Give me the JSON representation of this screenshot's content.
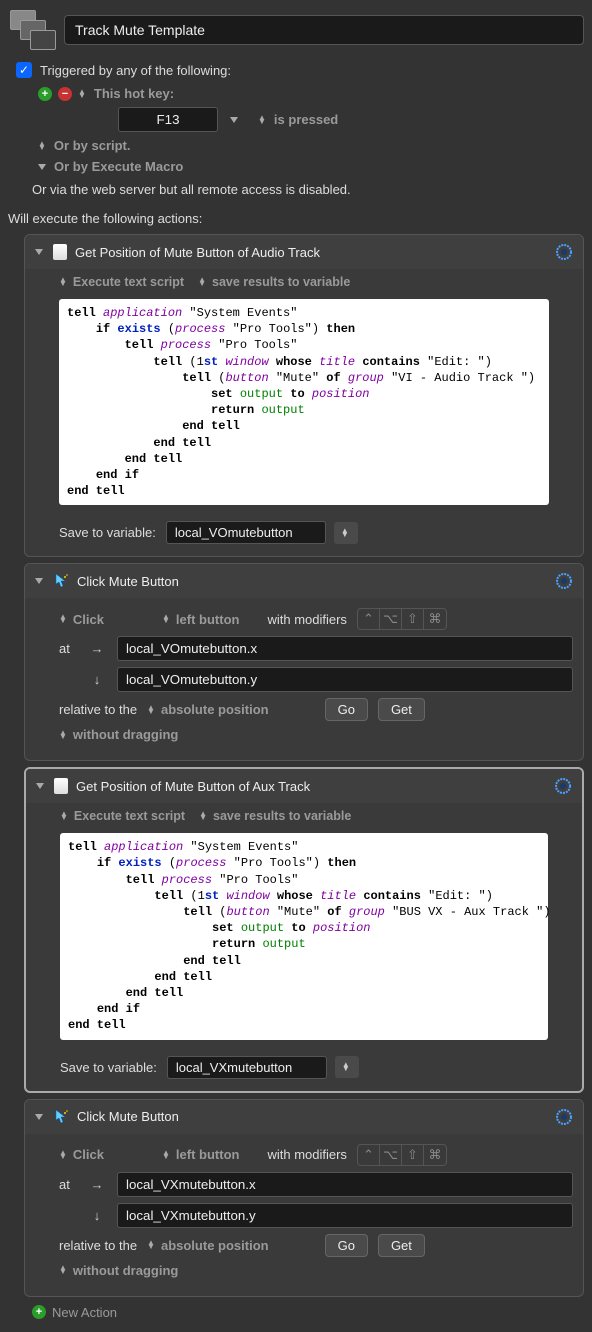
{
  "macro": {
    "title": "Track Mute Template",
    "triggered_label": "Triggered by any of the following:",
    "hotkey_label": "This hot key:",
    "hotkey_value": "F13",
    "hotkey_state": "is pressed",
    "or_script": "Or by script.",
    "or_execute": "Or by Execute Macro",
    "or_web": "Or via the web server but all remote access is disabled.",
    "will_execute": "Will execute the following actions:"
  },
  "actions": [
    {
      "title": "Get Position of Mute Button of Audio Track",
      "sub1": "Execute text script",
      "sub2": "save results to variable",
      "save_label": "Save to variable:",
      "save_var": "local_VOmutebutton"
    },
    {
      "title": "Click Mute Button",
      "click_label": "Click",
      "button_label": "left button",
      "with_mods": "with modifiers",
      "at": "at",
      "x": "local_VOmutebutton.x",
      "y": "local_VOmutebutton.y",
      "rel": "relative to the",
      "abs": "absolute position",
      "go": "Go",
      "get": "Get",
      "drag": "without dragging"
    },
    {
      "title": "Get Position of Mute Button of Aux Track",
      "sub1": "Execute text script",
      "sub2": "save results to variable",
      "save_label": "Save to variable:",
      "save_var": "local_VXmutebutton"
    },
    {
      "title": "Click Mute Button",
      "click_label": "Click",
      "button_label": "left button",
      "with_mods": "with modifiers",
      "at": "at",
      "x": "local_VXmutebutton.x",
      "y": "local_VXmutebutton.y",
      "rel": "relative to the",
      "abs": "absolute position",
      "go": "Go",
      "get": "Get",
      "drag": "without dragging"
    }
  ],
  "script1_group": "VI - Audio Track ",
  "script2_group": "BUS VX - Aux Track ",
  "new_action": "New Action"
}
